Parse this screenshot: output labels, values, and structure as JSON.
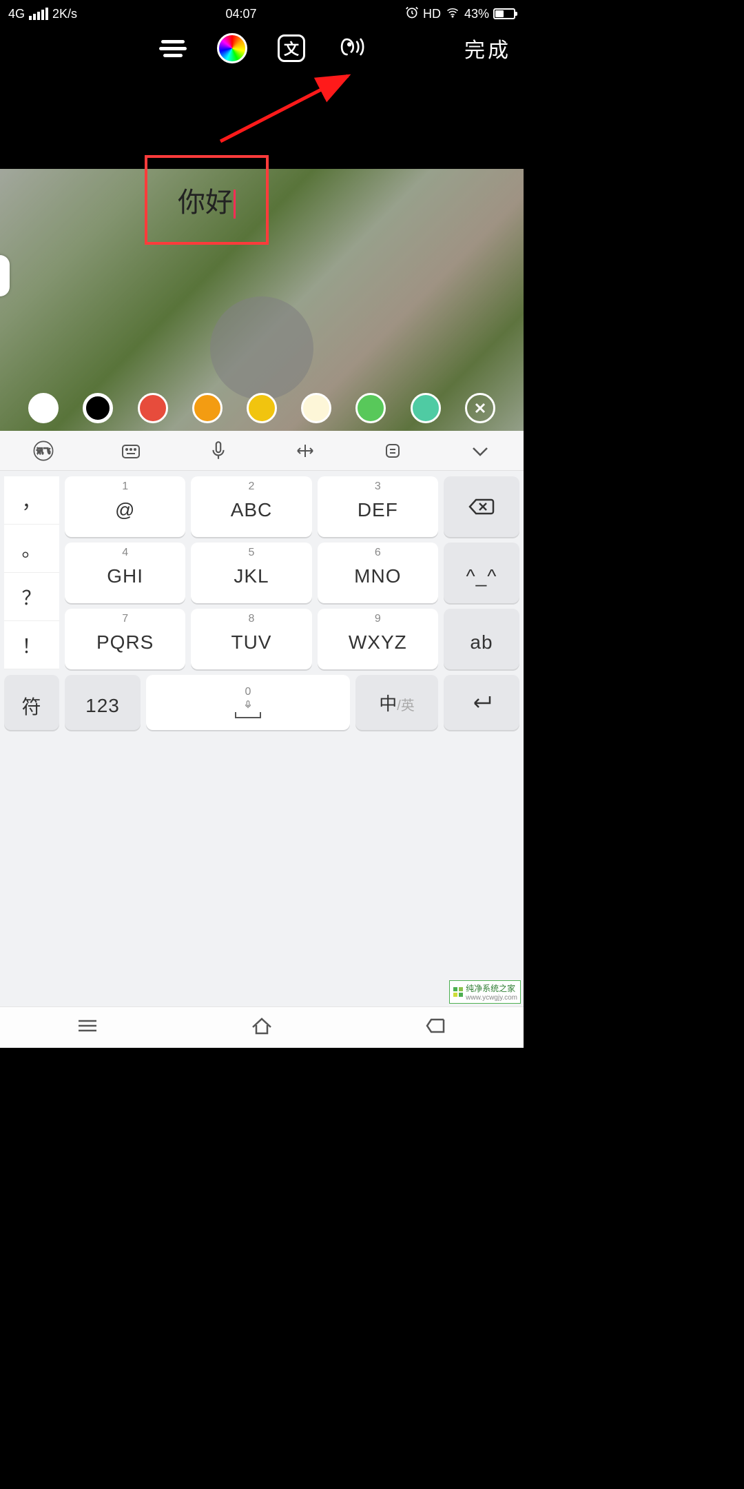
{
  "status": {
    "network": "4G",
    "speed": "2K/s",
    "time": "04:07",
    "hd": "HD",
    "battery_pct": "43%"
  },
  "toolbar": {
    "done_label": "完成",
    "style_char": "文"
  },
  "text_input": {
    "value": "你好"
  },
  "swatches": {
    "colors": [
      "#ffffff",
      "#000000",
      "#e74c3c",
      "#f39c12",
      "#f1c40f",
      "#fdf6d8",
      "#58c85a",
      "#4fcba3"
    ],
    "selected_index": 1
  },
  "keyboard": {
    "toolbar_brand": "讯飞",
    "side": [
      "，",
      "。",
      "？",
      "！"
    ],
    "rows": [
      [
        {
          "n": "1",
          "m": "@"
        },
        {
          "n": "2",
          "m": "ABC"
        },
        {
          "n": "3",
          "m": "DEF"
        }
      ],
      [
        {
          "n": "4",
          "m": "GHI"
        },
        {
          "n": "5",
          "m": "JKL"
        },
        {
          "n": "6",
          "m": "MNO"
        }
      ],
      [
        {
          "n": "7",
          "m": "PQRS"
        },
        {
          "n": "8",
          "m": "TUV"
        },
        {
          "n": "9",
          "m": "WXYZ"
        }
      ]
    ],
    "right": {
      "emoji": "^_^",
      "ab": "ab"
    },
    "bottom": {
      "sym": "符",
      "num": "123",
      "space_n": "0",
      "lang_zh": "中",
      "lang_sep": "/",
      "lang_en": "英"
    }
  },
  "watermark": {
    "brand": "纯净系统之家",
    "url": "www.ycwgjy.com"
  }
}
